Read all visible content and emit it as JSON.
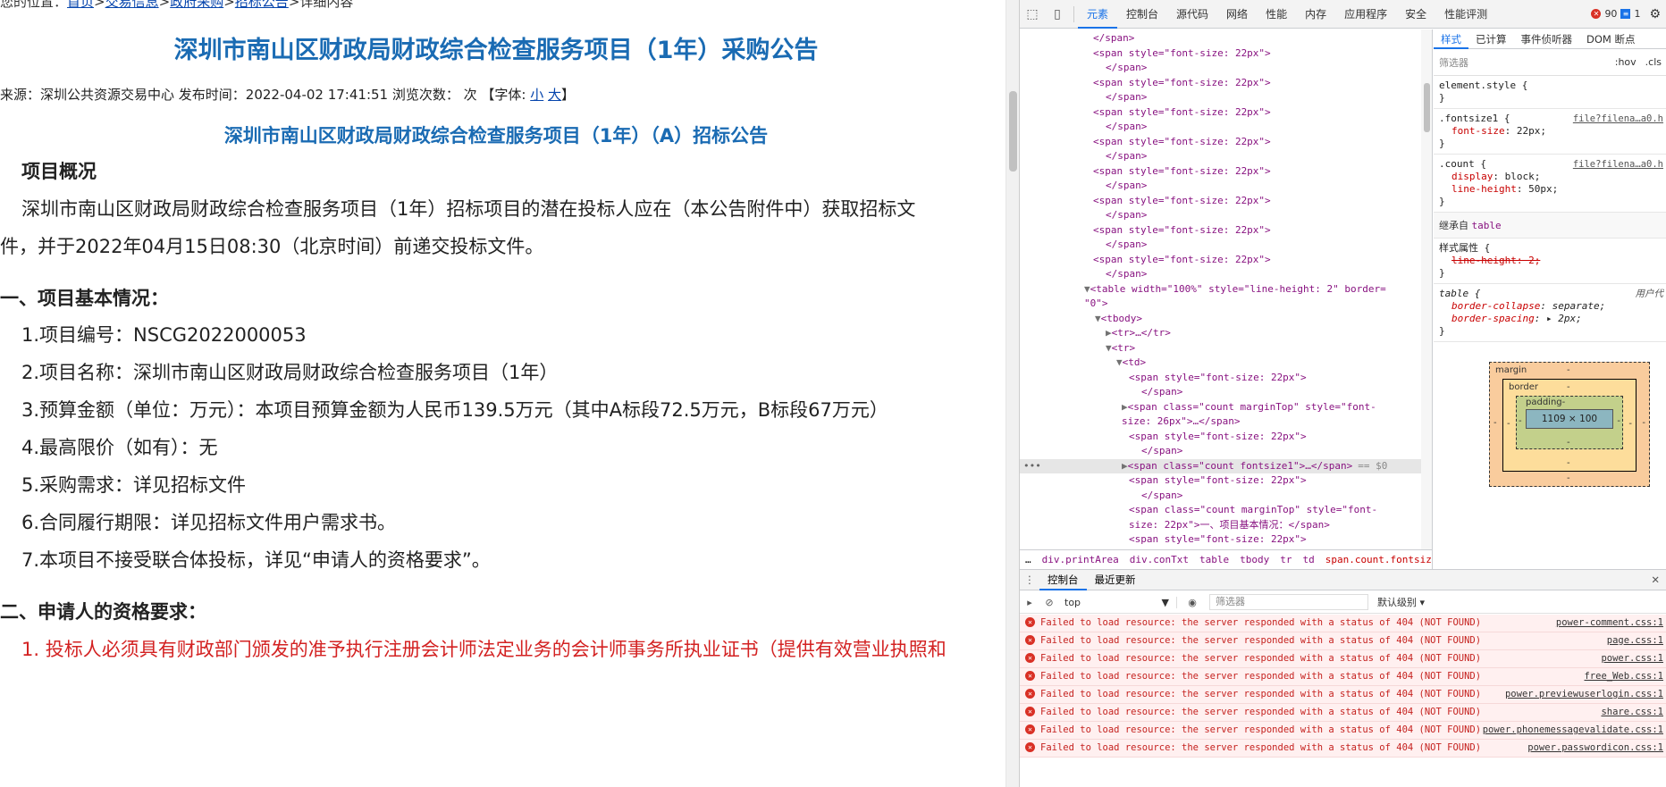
{
  "page": {
    "breadcrumb": {
      "prefix": "您的位置：",
      "home": "首页",
      "sep": ">",
      "c1": "交易信息",
      "c2": "政府采购",
      "c3": "招标公告",
      "current": "详细内容"
    },
    "title": "深圳市南山区财政局财政综合检查服务项目（1年）采购公告",
    "meta": {
      "prefix": "来源：深圳公共资源交易中心 发布时间：2022-04-02 17:41:51 浏览次数： 次 【字体: ",
      "small": "小",
      "large": "大",
      "suffix": "】"
    },
    "subtitle": "深圳市南山区财政局财政综合检查服务项目（1年）（A）招标公告",
    "overview_heading": "项目概况",
    "overview_line1": "深圳市南山区财政局财政综合检查服务项目（1年）招标项目的潜在投标人应在（本公告附件中）获取招标文",
    "overview_line2": "件，并于2022年04月15日08:30（北京时间）前递交投标文件。",
    "section1": "一、项目基本情况：",
    "items": [
      "1.项目编号：NSCG2022000053",
      "2.项目名称：深圳市南山区财政局财政综合检查服务项目（1年）",
      "3.预算金额（单位：万元）：本项目预算金额为人民币139.5万元（其中A标段72.5万元，B标段67万元）",
      "4.最高限价（如有）：无",
      "5.采购需求：详见招标文件",
      "6.合同履行期限：详见招标文件用户需求书。",
      "7.本项目不接受联合体投标，详见“申请人的资格要求”。"
    ],
    "section2": "二、申请人的资格要求：",
    "req1": "1. 投标人必须具有财政部门颁发的准予执行注册会计师法定业务的会计师事务所执业证书（提供有效营业执照和"
  },
  "devtools": {
    "tabs": [
      "元素",
      "控制台",
      "源代码",
      "网络",
      "性能",
      "内存",
      "应用程序",
      "安全",
      "性能评测"
    ],
    "active_tab": "元素",
    "error_count": "90",
    "message_count": "1",
    "dom": {
      "span_open": "<span style=\"font-size: 22px\">",
      "span_close": "</span>",
      "table_open": "<table width=\"100%\" style=\"line-height: 2\" border=",
      "table_cont": "\"0\">",
      "tbody": "<tbody>",
      "tr_collapsed": "<tr>…</tr>",
      "tr": "<tr>",
      "td": "<td>",
      "span_margintop_26": "<span class=\"count marginTop\" style=\"font-",
      "span_margintop_26_cont": "size: 26px\">…</span>",
      "span_selected": "<span class=\"count fontsize1\">…</span>",
      "selected_marker": "== $0",
      "span_margintop_22": "<span class=\"count marginTop\" style=\"font-",
      "span_margintop_22_cont": "size: 22px\">一、项目基本情况：</span>"
    },
    "breadcrumbs": [
      "div.printArea",
      "div.conTxt",
      "table",
      "tbody",
      "tr",
      "td",
      "span.count.fontsize1"
    ],
    "styles": {
      "tabs": [
        "样式",
        "已计算",
        "事件侦听器",
        "DOM 断点"
      ],
      "filter_placeholder": "筛选器",
      "hov": ":hov",
      "cls": ".cls",
      "element_style": "element.style {",
      "rules": [
        {
          "selector": ".fontsize1 {",
          "source": "file?filena…a0.h",
          "props": [
            [
              "font-size",
              "22px;"
            ]
          ]
        },
        {
          "selector": ".count {",
          "source": "file?filena…a0.h",
          "props": [
            [
              "display",
              "block;"
            ],
            [
              "line-height",
              "50px;"
            ]
          ]
        }
      ],
      "inherited_label": "继承自",
      "inherited_tag": "table",
      "style_attr_label": "样式属性 {",
      "style_attr_prop": "line-height: 2;",
      "table_rule_selector": "table {",
      "table_rule_source": "用户代",
      "table_rule_props": [
        [
          "border-collapse",
          "separate;"
        ],
        [
          "border-spacing",
          "▸ 2px;"
        ]
      ],
      "boxmodel": {
        "margin": "margin",
        "border": "border",
        "padding": "padding-",
        "content": "1109 × 100",
        "dash": "-"
      }
    },
    "drawer": {
      "tabs": [
        "控制台",
        "最近更新"
      ],
      "context": "top",
      "filter_placeholder": "筛选器",
      "level": "默认级别 ▾",
      "messages": [
        {
          "text": "Failed to load resource: the server responded with a status of 404 (NOT FOUND)",
          "src": "power-comment.css:1"
        },
        {
          "text": "Failed to load resource: the server responded with a status of 404 (NOT FOUND)",
          "src": "page.css:1"
        },
        {
          "text": "Failed to load resource: the server responded with a status of 404 (NOT FOUND)",
          "src": "power.css:1"
        },
        {
          "text": "Failed to load resource: the server responded with a status of 404 (NOT FOUND)",
          "src": "free_Web.css:1"
        },
        {
          "text": "Failed to load resource: the server responded with a status of 404 (NOT FOUND)",
          "src": "power.previewuserlogin.css:1"
        },
        {
          "text": "Failed to load resource: the server responded with a status of 404 (NOT FOUND)",
          "src": "share.css:1"
        },
        {
          "text": "Failed to load resource: the server responded with a status of 404 (NOT FOUND)",
          "src": "power.phonemessagevalidate.css:1"
        },
        {
          "text": "Failed to load resource: the server responded with a status of 404 (NOT FOUND)",
          "src": "power.passwordicon.css:1"
        }
      ]
    }
  }
}
